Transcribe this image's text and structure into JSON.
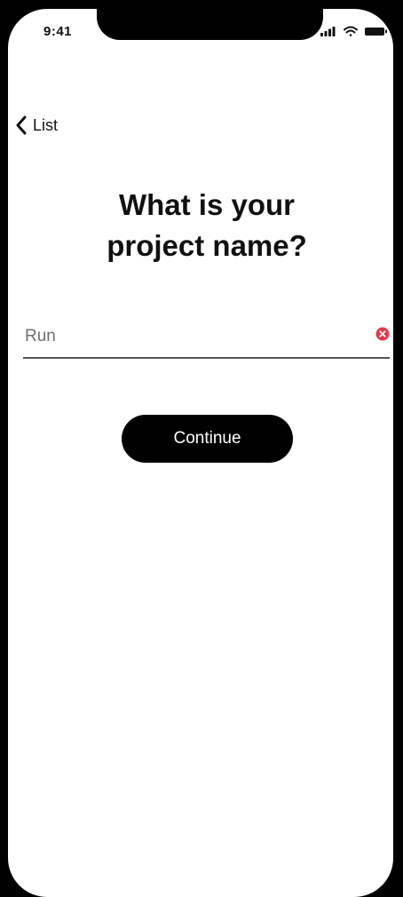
{
  "status_bar": {
    "time": "9:41",
    "icons": [
      "cellular-signal-icon",
      "wifi-icon",
      "battery-icon"
    ]
  },
  "nav": {
    "back_label": "List",
    "back_icon": "chevron-left-icon"
  },
  "main": {
    "title_line1": "What is your",
    "title_line2": "project name?",
    "project_name_value": "Run",
    "clear_icon": "clear-input-icon",
    "continue_label": "Continue"
  },
  "colors": {
    "background": "#ffffff",
    "frame": "#000000",
    "primary_button": "#000000",
    "clear_icon": "#e5384a"
  }
}
